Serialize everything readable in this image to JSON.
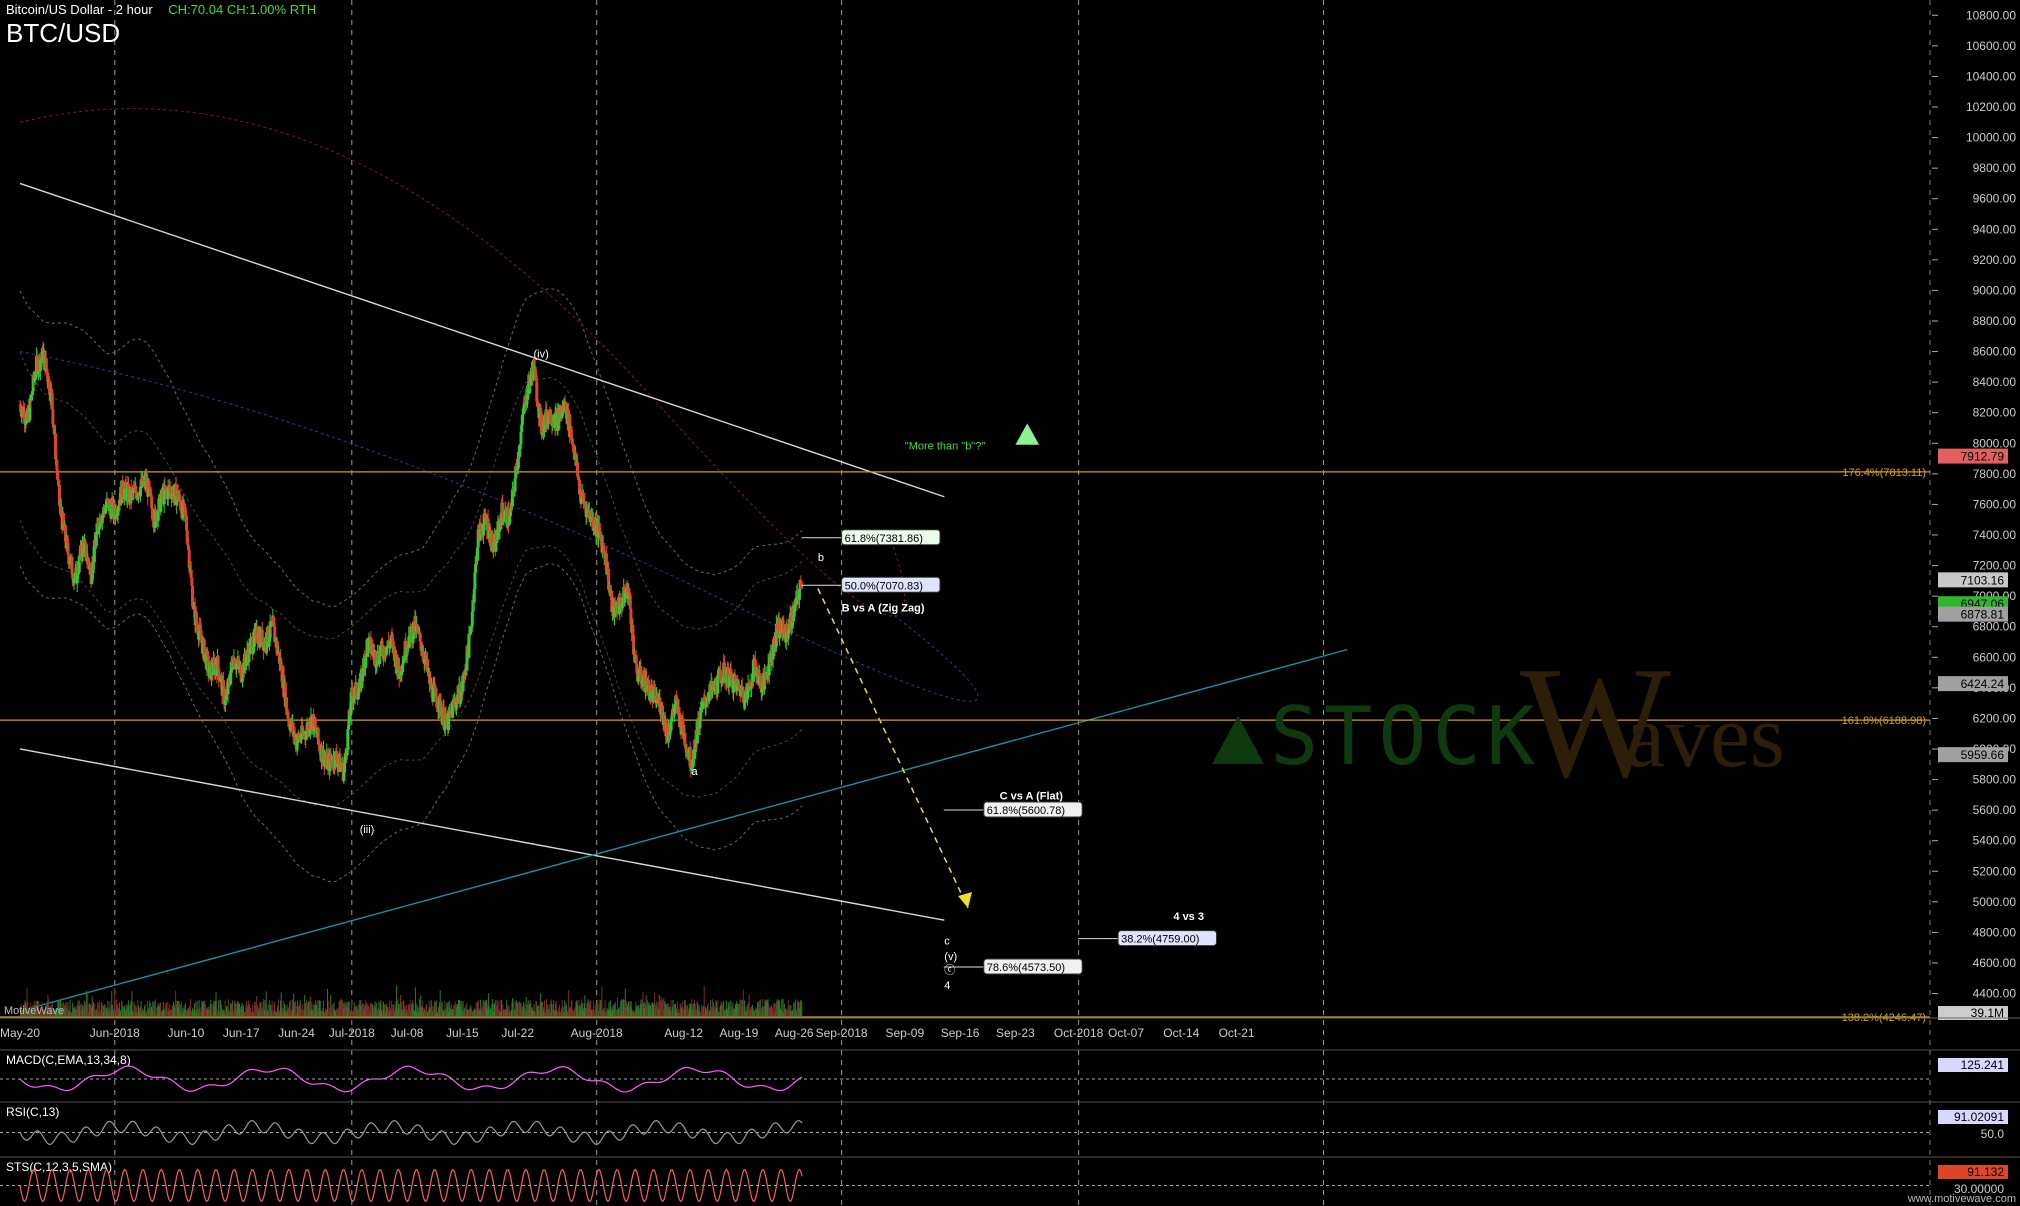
{
  "header": {
    "instrument": "Bitcoin/US Dollar - 2 hour",
    "stats": "CH:70.04  CH:1.00%  RTH",
    "symbol": "BTC/USD"
  },
  "branding": {
    "platform": "MotiveWave",
    "watermark": "www.motivewave.com",
    "logo_left": "STOCK",
    "logo_w": "W",
    "logo_right": "aves"
  },
  "colors": {
    "background": "#000000",
    "grid": "#9a9a9a",
    "candle_up": "#35c935",
    "candle_down": "#e0452a",
    "fib_line": "#d4a017",
    "trend_white": "#d8d8d8",
    "trend_teal": "#1f8ea3",
    "projection": "#f0e020",
    "macd": "#ff5cff",
    "rsi": "#999999",
    "stoch": "#ff5c5c"
  },
  "chart_data": {
    "type": "candlestick",
    "title": "BTC/USD",
    "ylim": [
      4240,
      10900
    ],
    "price_ticks": [
      4400,
      4600,
      4800,
      5000,
      5200,
      5400,
      5600,
      5800,
      6000,
      6200,
      6400,
      6600,
      6800,
      7000,
      7200,
      7400,
      7600,
      7800,
      8000,
      8200,
      8400,
      8600,
      8800,
      9000,
      9200,
      9400,
      9600,
      9800,
      10000,
      10200,
      10400,
      10600,
      10800
    ],
    "price_tick_labels": [
      "4400.00",
      "4600.00",
      "4800.00",
      "5000.00",
      "5200.00",
      "5400.00",
      "5600.00",
      "5800.00",
      "6000.00",
      "6200.00",
      "6400.00",
      "6600.00",
      "6800.00",
      "7000.00",
      "7200.00",
      "7400.00",
      "7600.00",
      "7800.00",
      "8000.00",
      "8200.00",
      "8400.00",
      "8600.00",
      "8800.00",
      "9000.00",
      "9200.00",
      "9400.00",
      "9600.00",
      "9800.00",
      "10000.00",
      "10200.00",
      "10400.00",
      "10600.00",
      "10800.00"
    ],
    "x_ticks": [
      {
        "label": "May-20",
        "day": 0
      },
      {
        "label": "Jun-2018",
        "day": 12
      },
      {
        "label": "Jun-10",
        "day": 21
      },
      {
        "label": "Jun-17",
        "day": 28
      },
      {
        "label": "Jun-24",
        "day": 35
      },
      {
        "label": "Jul-2018",
        "day": 42
      },
      {
        "label": "Jul-08",
        "day": 49
      },
      {
        "label": "Jul-15",
        "day": 56
      },
      {
        "label": "Jul-22",
        "day": 63
      },
      {
        "label": "Aug-2018",
        "day": 73
      },
      {
        "label": "Aug-12",
        "day": 84
      },
      {
        "label": "Aug-19",
        "day": 91
      },
      {
        "label": "Aug-26",
        "day": 98
      },
      {
        "label": "Sep-2018",
        "day": 104
      },
      {
        "label": "Sep-09",
        "day": 112
      },
      {
        "label": "Sep-16",
        "day": 119
      },
      {
        "label": "Sep-23",
        "day": 126
      },
      {
        "label": "Oct-2018",
        "day": 134
      },
      {
        "label": "Oct-07",
        "day": 140
      },
      {
        "label": "Oct-14",
        "day": 147
      },
      {
        "label": "Oct-21",
        "day": 154
      }
    ],
    "dashed_grid_days": [
      12,
      42,
      73,
      104,
      134,
      165
    ],
    "price_path": [
      [
        0,
        8250
      ],
      [
        1,
        8150
      ],
      [
        2,
        8500
      ],
      [
        3,
        8580
      ],
      [
        4,
        8300
      ],
      [
        5,
        7600
      ],
      [
        6,
        7300
      ],
      [
        7,
        7100
      ],
      [
        8,
        7350
      ],
      [
        9,
        7150
      ],
      [
        10,
        7500
      ],
      [
        11,
        7600
      ],
      [
        12,
        7550
      ],
      [
        13,
        7700
      ],
      [
        14,
        7650
      ],
      [
        15,
        7700
      ],
      [
        16,
        7750
      ],
      [
        17,
        7500
      ],
      [
        18,
        7650
      ],
      [
        19,
        7700
      ],
      [
        20,
        7650
      ],
      [
        21,
        7500
      ],
      [
        22,
        6900
      ],
      [
        23,
        6700
      ],
      [
        24,
        6500
      ],
      [
        25,
        6550
      ],
      [
        26,
        6300
      ],
      [
        27,
        6600
      ],
      [
        28,
        6500
      ],
      [
        29,
        6650
      ],
      [
        30,
        6750
      ],
      [
        31,
        6700
      ],
      [
        32,
        6800
      ],
      [
        33,
        6550
      ],
      [
        34,
        6200
      ],
      [
        35,
        6050
      ],
      [
        36,
        6100
      ],
      [
        37,
        6200
      ],
      [
        38,
        6000
      ],
      [
        39,
        5900
      ],
      [
        40,
        5950
      ],
      [
        41,
        5850
      ],
      [
        42,
        6350
      ],
      [
        43,
        6400
      ],
      [
        44,
        6700
      ],
      [
        45,
        6600
      ],
      [
        46,
        6650
      ],
      [
        47,
        6700
      ],
      [
        48,
        6500
      ],
      [
        49,
        6700
      ],
      [
        50,
        6800
      ],
      [
        51,
        6650
      ],
      [
        52,
        6400
      ],
      [
        53,
        6300
      ],
      [
        54,
        6150
      ],
      [
        55,
        6300
      ],
      [
        56,
        6400
      ],
      [
        57,
        6750
      ],
      [
        58,
        7400
      ],
      [
        59,
        7500
      ],
      [
        60,
        7300
      ],
      [
        61,
        7550
      ],
      [
        62,
        7500
      ],
      [
        63,
        7900
      ],
      [
        64,
        8300
      ],
      [
        65,
        8500
      ],
      [
        66,
        8100
      ],
      [
        67,
        8200
      ],
      [
        68,
        8150
      ],
      [
        69,
        8250
      ],
      [
        70,
        8000
      ],
      [
        71,
        7650
      ],
      [
        72,
        7550
      ],
      [
        73,
        7450
      ],
      [
        74,
        7300
      ],
      [
        75,
        6900
      ],
      [
        76,
        6950
      ],
      [
        77,
        7050
      ],
      [
        78,
        6500
      ],
      [
        79,
        6450
      ],
      [
        80,
        6350
      ],
      [
        81,
        6300
      ],
      [
        82,
        6100
      ],
      [
        83,
        6300
      ],
      [
        84,
        6100
      ],
      [
        85,
        5900
      ],
      [
        86,
        6200
      ],
      [
        87,
        6350
      ],
      [
        88,
        6400
      ],
      [
        89,
        6500
      ],
      [
        90,
        6450
      ],
      [
        91,
        6400
      ],
      [
        92,
        6350
      ],
      [
        93,
        6550
      ],
      [
        94,
        6400
      ],
      [
        95,
        6600
      ],
      [
        96,
        6800
      ],
      [
        97,
        6750
      ],
      [
        98,
        6900
      ],
      [
        99,
        7100
      ]
    ],
    "fib_lines": [
      {
        "label": "176.4%(7813.11)",
        "price": 7813.11
      },
      {
        "label": "161.8%(6188.98)",
        "price": 6188.98
      },
      {
        "label": "138.2%(4246.47)",
        "price": 4246.47
      }
    ],
    "price_markers": [
      {
        "label": "7912.79",
        "price": 7912.79,
        "color": "#e06060"
      },
      {
        "label": "7103.16",
        "price": 7103.16,
        "color": "#c8c8c8"
      },
      {
        "label": "6947.06",
        "price": 6947.06,
        "color": "#2fb82f"
      },
      {
        "label": "6878.81",
        "price": 6878.81,
        "color": "#a0a0a0"
      },
      {
        "label": "6424.24",
        "price": 6424.24,
        "color": "#a0a0a0"
      },
      {
        "label": "5959.66",
        "price": 5959.66,
        "color": "#a0a0a0"
      }
    ],
    "fib_targets": [
      {
        "label": "61.8%(7381.86)",
        "price": 7381.86,
        "day": 104,
        "bg": "#eaffea"
      },
      {
        "label": "50.0%(7070.83)",
        "price": 7070.83,
        "day": 104,
        "bg": "#e0e4ff"
      },
      {
        "label": "61.8%(5600.78)",
        "price": 5600.78,
        "day": 122,
        "bg": "#f0f0f0"
      },
      {
        "label": "38.2%(4759.00)",
        "price": 4759.0,
        "day": 139,
        "bg": "#e0e4ff"
      },
      {
        "label": "78.6%(4573.50)",
        "price": 4573.5,
        "day": 122,
        "bg": "#f0f0f0"
      }
    ],
    "annotations": [
      {
        "text": "(iv)",
        "day": 65,
        "price": 8560
      },
      {
        "text": "(iii)",
        "day": 43,
        "price": 5450
      },
      {
        "text": "a",
        "day": 85,
        "price": 5830
      },
      {
        "text": "b",
        "day": 101,
        "price": 7230
      },
      {
        "text": "B vs A (Zig Zag)",
        "day": 104,
        "price": 6900,
        "bold": true
      },
      {
        "text": "C vs A (Flat)",
        "day": 124,
        "price": 5670,
        "bold": true
      },
      {
        "text": "4 vs 3",
        "day": 146,
        "price": 4880,
        "bold": true
      },
      {
        "text": "c",
        "day": 117,
        "price": 4720
      },
      {
        "text": "(v)",
        "day": 117,
        "price": 4620
      },
      {
        "text": "ⓒ",
        "day": 117,
        "price": 4530
      },
      {
        "text": "4",
        "day": 117,
        "price": 4430
      },
      {
        "text": "\"More than \"b\"?\"",
        "day": 112,
        "price": 7960,
        "color": "#3fdc3f"
      }
    ],
    "trendlines": [
      {
        "from": [
          0,
          9700
        ],
        "to": [
          117,
          7650
        ],
        "color": "#d8d8d8"
      },
      {
        "from": [
          0,
          6000
        ],
        "to": [
          117,
          4880
        ],
        "color": "#d8d8d8"
      },
      {
        "from": [
          1,
          4300
        ],
        "to": [
          168,
          6650
        ],
        "color": "#1f8ea3"
      }
    ],
    "projection": {
      "from": [
        101,
        7050
      ],
      "to": [
        120,
        4960
      ]
    },
    "indicators": [
      {
        "name": "MACD(C,EMA,13,34,8)",
        "value": "125.241"
      },
      {
        "name": "RSI(C,13)",
        "value": "91.02091",
        "level": "50.0"
      },
      {
        "name": "STS(C,12,3,5,SMA)",
        "value": "91.132",
        "level": "30.00000"
      }
    ],
    "volume_value": "39.1M"
  }
}
